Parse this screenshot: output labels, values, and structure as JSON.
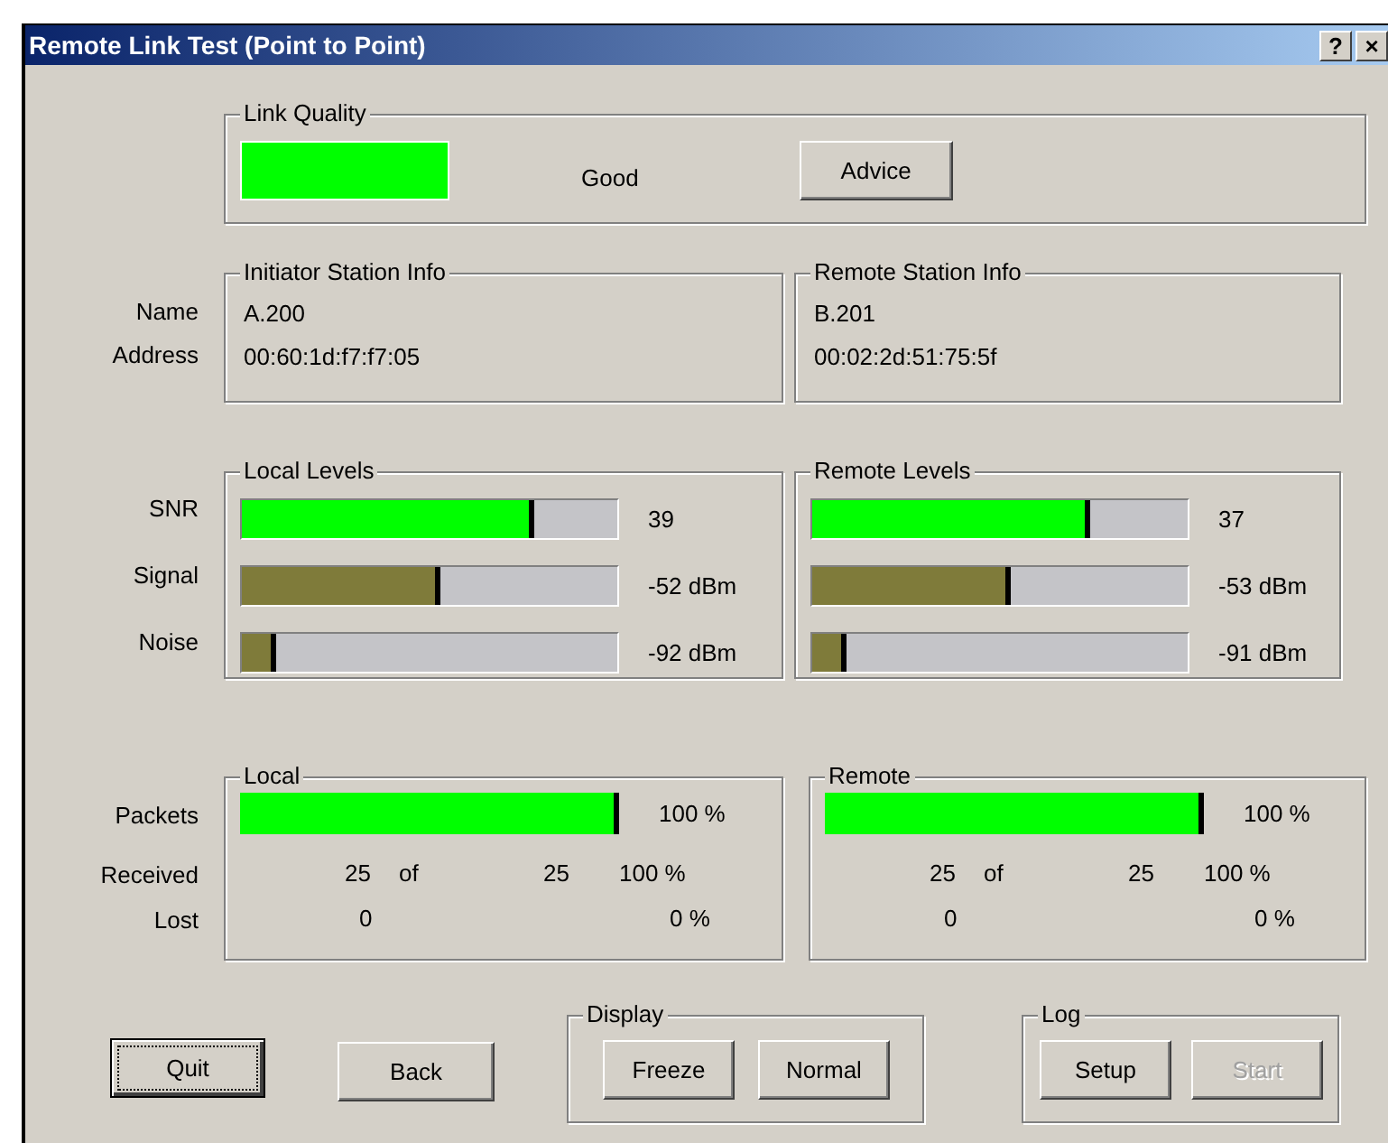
{
  "window": {
    "title": "Remote Link Test (Point to Point)",
    "help_button": "?",
    "close_button": "×"
  },
  "link_quality": {
    "legend": "Link Quality",
    "color": "#00ff00",
    "status": "Good",
    "advice_button": {
      "label": "Advice"
    }
  },
  "station_labels": [
    "Name",
    "Address"
  ],
  "stations": [
    {
      "legend": "Initiator Station Info",
      "name": "A.200",
      "address": "00:60:1d:f7:f7:05"
    },
    {
      "legend": "Remote Station Info",
      "name": "B.201",
      "address": "00:02:2d:51:75:5f"
    }
  ],
  "level_labels": [
    "SNR",
    "Signal",
    "Noise"
  ],
  "levels": [
    {
      "legend": "Local Levels",
      "rows": [
        {
          "level": 0.78,
          "color": "#00ff00",
          "reading": "39"
        },
        {
          "level": 0.53,
          "color": "#7f7b3a",
          "reading": "-52 dBm"
        },
        {
          "level": 0.09,
          "color": "#7f7b3a",
          "reading": "-92 dBm"
        }
      ]
    },
    {
      "legend": "Remote Levels",
      "rows": [
        {
          "level": 0.74,
          "color": "#00ff00",
          "reading": "37"
        },
        {
          "level": 0.53,
          "color": "#7f7b3a",
          "reading": "-53 dBm"
        },
        {
          "level": 0.09,
          "color": "#7f7b3a",
          "reading": "-91 dBm"
        }
      ]
    }
  ],
  "packet_labels": [
    "Packets",
    "Received",
    "Lost"
  ],
  "packets": [
    {
      "legend": "Local",
      "level": 1,
      "percent": "100 %",
      "received": "25",
      "of": "of",
      "total": "25",
      "received_percent": "100 %",
      "lost": "0",
      "lost_percent": "0 %"
    },
    {
      "legend": "Remote",
      "level": 1,
      "percent": "100 %",
      "received": "25",
      "of": "of",
      "total": "25",
      "received_percent": "100 %",
      "lost": "0",
      "lost_percent": "0 %"
    }
  ],
  "quit_button": {
    "label": "Quit",
    "focused": true
  },
  "back_button": {
    "label": "Back"
  },
  "display": {
    "legend": "Display",
    "buttons": [
      {
        "label": "Freeze",
        "disabled": false
      },
      {
        "label": "Normal",
        "disabled": false
      }
    ]
  },
  "log": {
    "legend": "Log",
    "buttons": [
      {
        "label": "Setup",
        "disabled": false
      },
      {
        "label": "Start",
        "disabled": true
      }
    ]
  }
}
